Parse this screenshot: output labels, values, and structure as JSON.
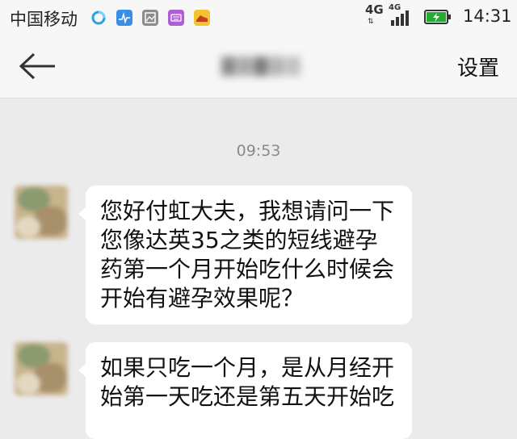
{
  "status_bar": {
    "carrier": "中国移动",
    "network_1": "4G",
    "network_2": "4G",
    "time": "14:31",
    "icons": [
      "browser-icon",
      "chart-app-icon",
      "gallery-icon",
      "keyboard-icon",
      "shoe-app-icon"
    ],
    "battery_color": "#22aa33"
  },
  "header": {
    "back_icon": "arrow-left-icon",
    "settings_label": "设置"
  },
  "chat": {
    "timestamp": "09:53",
    "messages": [
      {
        "text": "您好付虹大夫，我想请问一下您像达英35之类的短线避孕药第一个月开始吃什么时候会开始有避孕效果呢？"
      },
      {
        "text": "如果只吃一个月，是从月经开始第一天吃还是第五天开始吃"
      }
    ]
  }
}
